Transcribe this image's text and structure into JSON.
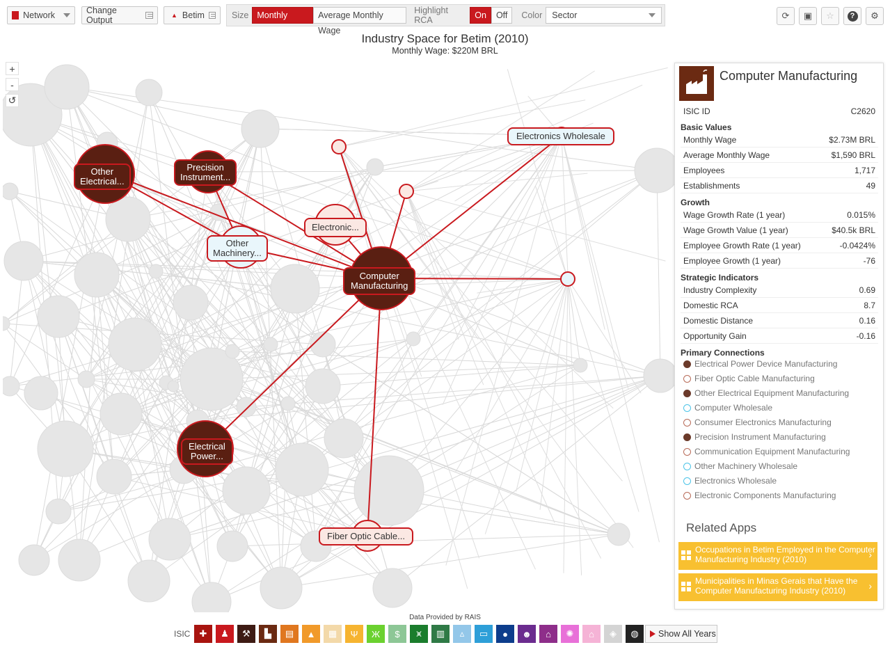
{
  "toolbar": {
    "app_label": "Network",
    "change_output": "Change Output",
    "location": "Betim",
    "size_label": "Size",
    "size_options": [
      "Monthly Wage",
      "Average Monthly Wage"
    ],
    "size_selected": "Monthly Wage",
    "rca_label": "Highlight RCA",
    "rca_on": "On",
    "rca_off": "Off",
    "rca_selected": "On",
    "color_label": "Color",
    "color_value": "Sector",
    "right_icons": [
      "refresh-icon",
      "save-icon",
      "star-icon",
      "help-icon",
      "settings-icon"
    ]
  },
  "header": {
    "title": "Industry Space for Betim (2010)",
    "subtitle": "Monthly Wage: $220M BRL"
  },
  "zoom": {
    "in": "+",
    "out": "-",
    "reset": "↺"
  },
  "network_labels": {
    "other_electrical": "Other\nElectrical...",
    "precision": "Precision\nInstrument...",
    "electronic": "Electronic...",
    "other_machinery": "Other\nMachinery...",
    "computer_mfg": "Computer\nManufacturing",
    "electronics_wholesale": "Electronics Wholesale",
    "electrical_power": "Electrical\nPower...",
    "fiber_optic": "Fiber Optic Cable..."
  },
  "panel": {
    "title": "Computer Manufacturing",
    "isic_label": "ISIC ID",
    "isic_value": "C2620",
    "basic_title": "Basic Values",
    "basic": [
      {
        "label": "Monthly Wage",
        "value": "$2.73M BRL"
      },
      {
        "label": "Average Monthly Wage",
        "value": "$1,590 BRL"
      },
      {
        "label": "Employees",
        "value": "1,717"
      },
      {
        "label": "Establishments",
        "value": "49"
      }
    ],
    "growth_title": "Growth",
    "growth": [
      {
        "label": "Wage Growth Rate (1 year)",
        "value": "0.015%"
      },
      {
        "label": "Wage Growth Value (1 year)",
        "value": "$40.5k BRL"
      },
      {
        "label": "Employee Growth Rate (1 year)",
        "value": "-0.0424%"
      },
      {
        "label": "Employee Growth (1 year)",
        "value": "-76"
      }
    ],
    "strategic_title": "Strategic Indicators",
    "strategic": [
      {
        "label": "Industry Complexity",
        "value": "0.69"
      },
      {
        "label": "Domestic RCA",
        "value": "8.7"
      },
      {
        "label": "Domestic Distance",
        "value": "0.16"
      },
      {
        "label": "Opportunity Gain",
        "value": "-0.16"
      }
    ],
    "connections_title": "Primary Connections",
    "connections": [
      {
        "label": "Electrical Power Device Manufacturing",
        "fill": "#6b3a2a",
        "stroke": "#6b3a2a"
      },
      {
        "label": "Fiber Optic Cable Manufacturing",
        "fill": "#ffffff",
        "stroke": "#b86b58"
      },
      {
        "label": "Other Electrical Equipment Manufacturing",
        "fill": "#6b3a2a",
        "stroke": "#6b3a2a"
      },
      {
        "label": "Computer Wholesale",
        "fill": "#ffffff",
        "stroke": "#4cc4e8"
      },
      {
        "label": "Consumer Electronics Manufacturing",
        "fill": "#ffffff",
        "stroke": "#b86b58"
      },
      {
        "label": "Precision Instrument Manufacturing",
        "fill": "#6b3a2a",
        "stroke": "#6b3a2a"
      },
      {
        "label": "Communication Equipment Manufacturing",
        "fill": "#ffffff",
        "stroke": "#b86b58"
      },
      {
        "label": "Other Machinery Wholesale",
        "fill": "#ffffff",
        "stroke": "#4cc4e8"
      },
      {
        "label": "Electronics Wholesale",
        "fill": "#ffffff",
        "stroke": "#4cc4e8"
      },
      {
        "label": "Electronic Components Manufacturing",
        "fill": "#ffffff",
        "stroke": "#b86b58"
      }
    ],
    "related_title": "Related Apps",
    "related": [
      "Occupations in Betim Employed in the Computer Manufacturing Industry (2010)",
      "Municipalities in Minas Gerais that Have the Computer Manufacturing Industry (2010)"
    ]
  },
  "footer": {
    "provided": "Data Provided by RAIS",
    "legend_label": "ISIC",
    "show_all_years": "Show All Years",
    "sectors": [
      {
        "icon": "health-icon",
        "color": "#a8140f",
        "glyph": "✚"
      },
      {
        "icon": "people-icon",
        "color": "#c9191e",
        "glyph": "♟"
      },
      {
        "icon": "mining-icon",
        "color": "#3e1b14",
        "glyph": "⚒"
      },
      {
        "icon": "factory-icon",
        "color": "#6b2a12",
        "glyph": "▙"
      },
      {
        "icon": "book-icon",
        "color": "#e0771f",
        "glyph": "▤"
      },
      {
        "icon": "cone-icon",
        "color": "#f19a2a",
        "glyph": "▲"
      },
      {
        "icon": "buildings-icon",
        "color": "#f3d9a9",
        "glyph": "▦"
      },
      {
        "icon": "utensils-icon",
        "color": "#f6b430",
        "glyph": "Ψ"
      },
      {
        "icon": "tower-icon",
        "color": "#6bd12f",
        "glyph": "Ж"
      },
      {
        "icon": "money-icon",
        "color": "#8dc796",
        "glyph": "$"
      },
      {
        "icon": "bridge-icon",
        "color": "#1b7d2d",
        "glyph": "⩙"
      },
      {
        "icon": "bank-icon",
        "color": "#2f7a46",
        "glyph": "▥"
      },
      {
        "icon": "road-icon",
        "color": "#93c7e9",
        "glyph": "▵"
      },
      {
        "icon": "store-icon",
        "color": "#2e9fd8",
        "glyph": "▭"
      },
      {
        "icon": "water-icon",
        "color": "#0d3d8c",
        "glyph": "●"
      },
      {
        "icon": "masks-icon",
        "color": "#6b2c8f",
        "glyph": "☻"
      },
      {
        "icon": "school-icon",
        "color": "#8e2e8a",
        "glyph": "⌂"
      },
      {
        "icon": "compass-icon",
        "color": "#e870d8",
        "glyph": "✺"
      },
      {
        "icon": "house-icon",
        "color": "#f5b3d6",
        "glyph": "⌂"
      },
      {
        "icon": "box-icon",
        "color": "#d4d4d4",
        "glyph": "◈"
      },
      {
        "icon": "globe-icon",
        "color": "#222222",
        "glyph": "◍"
      }
    ]
  }
}
